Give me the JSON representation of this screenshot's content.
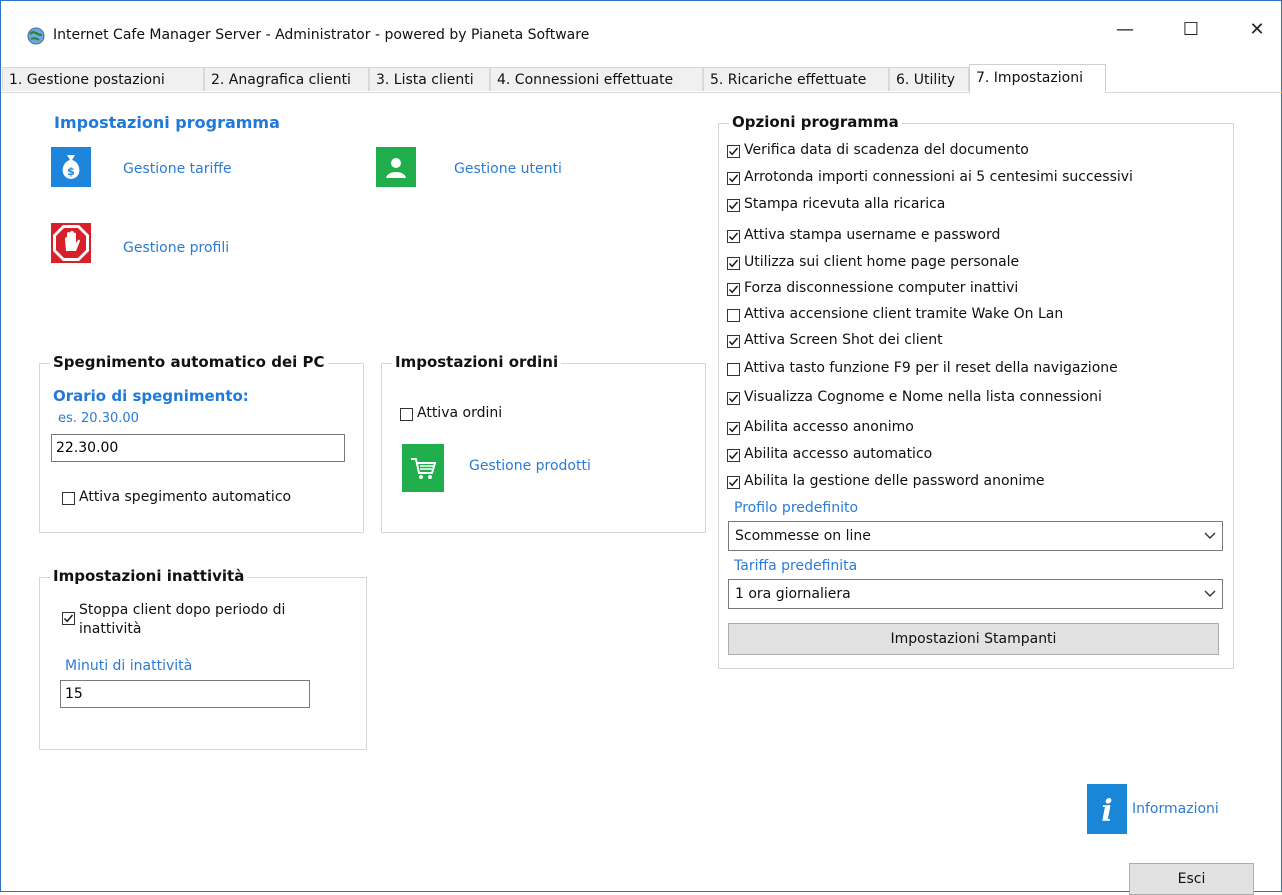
{
  "window": {
    "title": "Internet Cafe Manager Server - Administrator - powered by Pianeta Software",
    "minimize": "—",
    "maximize": "☐",
    "close": "✕"
  },
  "tabs": [
    {
      "label": "1. Gestione postazioni"
    },
    {
      "label": "2. Anagrafica clienti"
    },
    {
      "label": "3. Lista clienti"
    },
    {
      "label": "4. Connessioni effettuate"
    },
    {
      "label": "5. Ricariche effettuate"
    },
    {
      "label": "6. Utility"
    },
    {
      "label": "7. Impostazioni",
      "active": true
    }
  ],
  "program_settings": {
    "title": "Impostazioni programma",
    "tariffe": "Gestione tariffe",
    "utenti": "Gestione utenti",
    "profili": "Gestione profili"
  },
  "shutdown": {
    "title": "Spegnimento automatico dei PC",
    "time_label": "Orario di spegnimento:",
    "example": "es. 20.30.00",
    "value": "22.30.00",
    "auto_label": "Attiva spegimento automatico",
    "auto_checked": false
  },
  "orders": {
    "title": "Impostazioni ordini",
    "enable_label": "Attiva ordini",
    "enable_checked": false,
    "products": "Gestione prodotti"
  },
  "inactivity": {
    "title": "Impostazioni inattività",
    "stop_line1": "Stoppa client dopo periodo di",
    "stop_line2": "inattività",
    "stop_checked": true,
    "minutes_label": "Minuti di inattività",
    "minutes_value": "15"
  },
  "options": {
    "title": "Opzioni programma",
    "items": [
      {
        "label": "Verifica data di scadenza del documento",
        "checked": true
      },
      {
        "label": "Arrotonda importi connessioni ai 5 centesimi successivi",
        "checked": true
      },
      {
        "label": "Stampa ricevuta alla ricarica",
        "checked": true
      },
      {
        "label": "Attiva stampa username e password",
        "checked": true
      },
      {
        "label": "Utilizza sui client home page personale",
        "checked": true
      },
      {
        "label": "Forza disconnessione computer inattivi",
        "checked": true
      },
      {
        "label": "Attiva accensione client tramite Wake On Lan",
        "checked": false
      },
      {
        "label": "Attiva Screen Shot dei client",
        "checked": true
      },
      {
        "label": "Attiva tasto funzione F9 per il reset della navigazione",
        "checked": false
      },
      {
        "label": "Visualizza Cognome e Nome nella lista connessioni",
        "checked": true
      },
      {
        "label": "Abilita accesso anonimo",
        "checked": true
      },
      {
        "label": "Abilita accesso automatico",
        "checked": true
      },
      {
        "label": "Abilita la gestione delle password anonime",
        "checked": true
      }
    ],
    "profile_label": "Profilo predefinito",
    "profile_value": "Scommesse on line",
    "tariff_label": "Tariffa predefinita",
    "tariff_value": "1 ora giornaliera",
    "printers_button": "Impostazioni Stampanti"
  },
  "info_label": "Informazioni",
  "exit_button": "Esci"
}
